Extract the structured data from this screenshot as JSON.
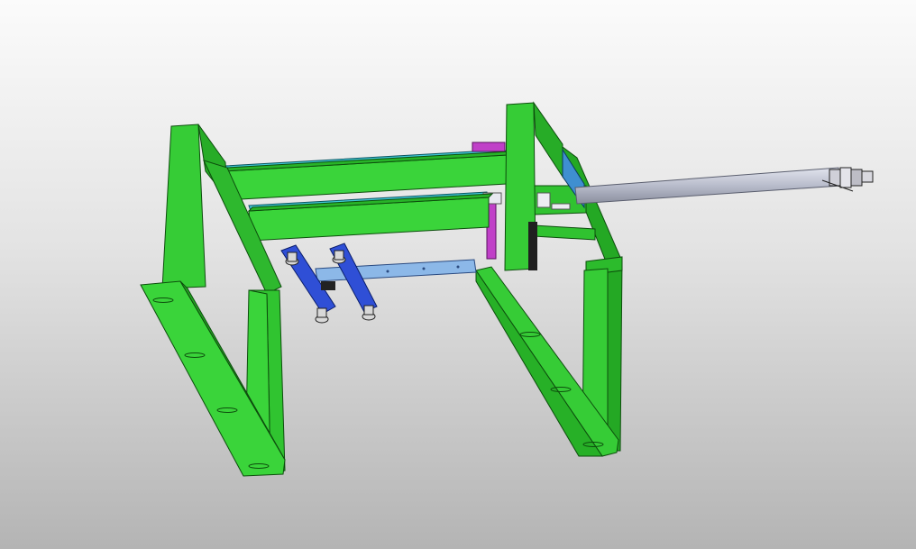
{
  "scene": {
    "colors": {
      "frame_light": "#3ad43a",
      "frame_mid": "#2cbb2c",
      "frame_dark": "#1c8f1c",
      "frame_edge": "#0d4d0d",
      "rail_cyan": "#3fc9d9",
      "gripper_blue": "#2f4fd6",
      "plate_lightblue": "#8cb8e8",
      "actuator_magenta": "#c040c8",
      "cylinder_gray": "#b8bccb",
      "fitting_dark": "#3a3a3a"
    },
    "components": [
      "green-frame",
      "linear-rail",
      "vacuum-gripper",
      "mounting-plate",
      "actuator",
      "pneumatic-cylinder"
    ]
  }
}
